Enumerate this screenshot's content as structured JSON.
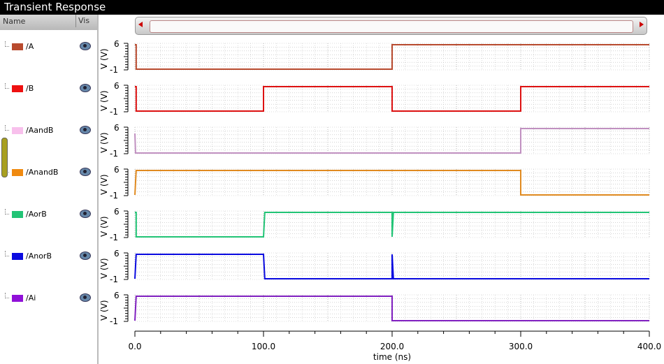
{
  "window": {
    "title": "Transient Response"
  },
  "panel": {
    "col_name": "Name",
    "col_vis": "Vis"
  },
  "signals": [
    {
      "name": "/A",
      "color": "#b84a2e",
      "line": "#b84a2e",
      "pts": [
        [
          0,
          5
        ],
        [
          1,
          5
        ],
        [
          1,
          0
        ],
        [
          200,
          0
        ],
        [
          200,
          5
        ],
        [
          400,
          5
        ]
      ]
    },
    {
      "name": "/B",
      "color": "#ee1111",
      "line": "#dd1111",
      "pts": [
        [
          0,
          5
        ],
        [
          1,
          5
        ],
        [
          1,
          0
        ],
        [
          100,
          0
        ],
        [
          100,
          5
        ],
        [
          200,
          5
        ],
        [
          200,
          0
        ],
        [
          300,
          0
        ],
        [
          300,
          5
        ],
        [
          400,
          5
        ]
      ]
    },
    {
      "name": "/AandB",
      "color": "#f8c0ec",
      "line": "#c090c0",
      "pts": [
        [
          0,
          4
        ],
        [
          0.5,
          0
        ],
        [
          300,
          0
        ],
        [
          300,
          5
        ],
        [
          400,
          5
        ]
      ]
    },
    {
      "name": "/AnandB",
      "color": "#f08a10",
      "line": "#e08a20",
      "pts": [
        [
          0,
          0
        ],
        [
          1,
          5
        ],
        [
          300,
          5
        ],
        [
          300,
          0
        ],
        [
          400,
          0
        ]
      ]
    },
    {
      "name": "/AorB",
      "color": "#22c476",
      "line": "#22c476",
      "pts": [
        [
          0,
          5
        ],
        [
          1,
          5
        ],
        [
          1,
          0
        ],
        [
          100,
          0
        ],
        [
          101,
          5
        ],
        [
          200,
          5
        ],
        [
          200,
          0
        ],
        [
          201,
          5
        ],
        [
          400,
          5
        ]
      ]
    },
    {
      "name": "/AnorB",
      "color": "#0a0ae0",
      "line": "#0a0ae0",
      "pts": [
        [
          0,
          0
        ],
        [
          1,
          5
        ],
        [
          100,
          5
        ],
        [
          101,
          0
        ],
        [
          200,
          0
        ],
        [
          200,
          5
        ],
        [
          201,
          0
        ],
        [
          400,
          0
        ]
      ]
    },
    {
      "name": "/Ai",
      "color": "#9010d8",
      "line": "#8020c0",
      "pts": [
        [
          0,
          0
        ],
        [
          1,
          5
        ],
        [
          200,
          5
        ],
        [
          200,
          0
        ],
        [
          400,
          0
        ]
      ]
    }
  ],
  "axis": {
    "ylabel": "V (V)",
    "ytop": "6",
    "ybot": "-1",
    "xlabel": "time (ns)",
    "xticks": [
      "0.0",
      "100.0",
      "200.0",
      "300.0",
      "400.0"
    ],
    "xlim": [
      0,
      400
    ],
    "ylim": [
      -1,
      6
    ]
  }
}
